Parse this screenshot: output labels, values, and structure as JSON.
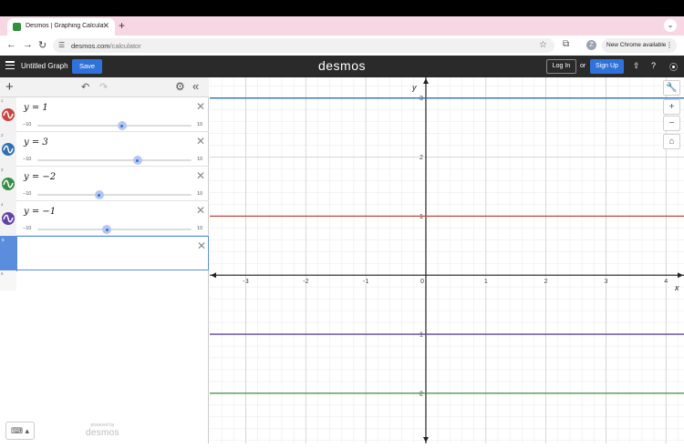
{
  "browser": {
    "tab_title": "Desmos | Graphing Calculator",
    "tab_close": "✕",
    "new_tab": "+",
    "tab_menu": "⌄",
    "back": "←",
    "forward": "→",
    "reload": "↻",
    "url_host": "desmos.com",
    "url_path": "/calculator",
    "profile_initial": "Z",
    "update_label": "New Chrome available",
    "more": "⋮"
  },
  "app": {
    "graph_title": "Untitled Graph",
    "save_label": "Save",
    "logo": "desmos",
    "login_label": "Log In",
    "or_label": "or",
    "signup_label": "Sign Up"
  },
  "expressions": [
    {
      "num": "1",
      "latex": "y = 1",
      "value": 1,
      "min": "−10",
      "max": "10",
      "color": "#c74440"
    },
    {
      "num": "2",
      "latex": "y = 3",
      "value": 3,
      "min": "−10",
      "max": "10",
      "color": "#2d70b3"
    },
    {
      "num": "3",
      "latex": "y = −2",
      "value": -2,
      "min": "−10",
      "max": "10",
      "color": "#388c46"
    },
    {
      "num": "4",
      "latex": "y = −1",
      "value": -1,
      "min": "−10",
      "max": "10",
      "color": "#6042a6"
    },
    {
      "num": "5",
      "latex": "",
      "active": true
    },
    {
      "num": "6",
      "latex": ""
    }
  ],
  "footer": {
    "powered_by": "powered by",
    "brand": "desmos"
  },
  "graph": {
    "x_axis_label": "x",
    "y_axis_label": "y",
    "x_range": [
      -3.6,
      4.3
    ],
    "y_range": [
      -2.85,
      3.35
    ],
    "x_ticks": [
      "-3",
      "-2",
      "-1",
      "0",
      "1",
      "2",
      "3",
      "4"
    ],
    "y_ticks": [
      "3",
      "2",
      "1",
      "-1",
      "-2"
    ],
    "lines": [
      {
        "y": 1,
        "color": "#c74440"
      },
      {
        "y": 3,
        "color": "#2d70b3"
      },
      {
        "y": -2,
        "color": "#388c46"
      },
      {
        "y": -1,
        "color": "#6042a6"
      }
    ]
  }
}
